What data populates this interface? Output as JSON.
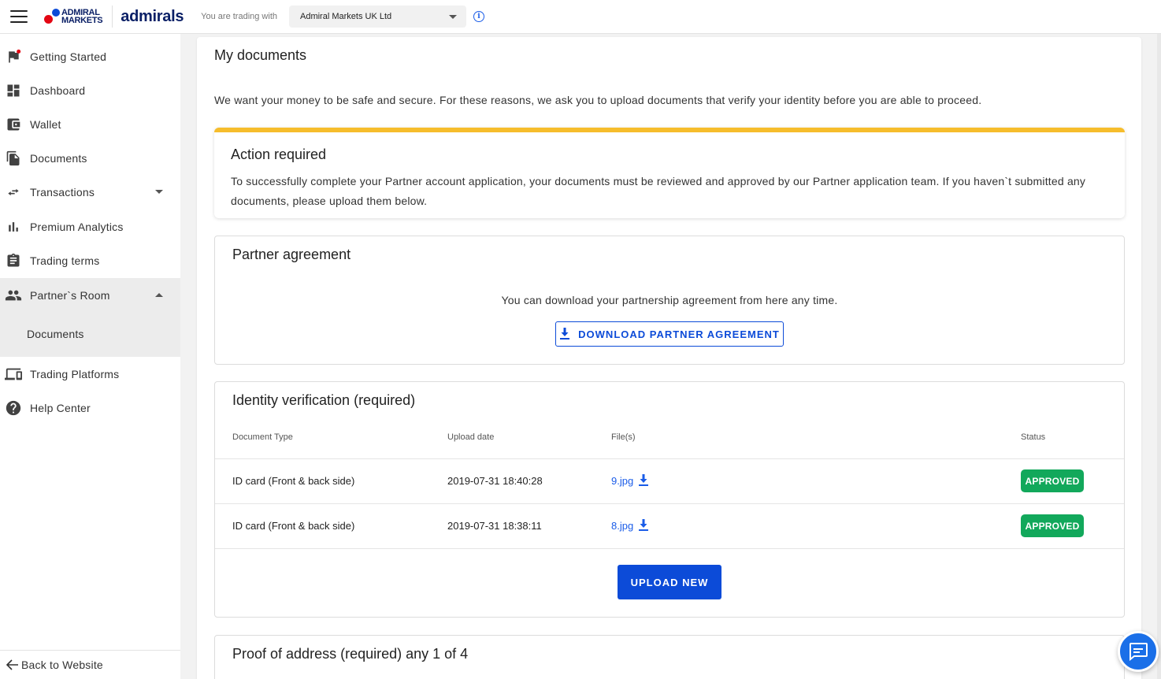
{
  "header": {
    "logo_line1": "ADMIRAL",
    "logo_line2": "MARKETS",
    "brand": "admirals",
    "trading_with_label": "You are trading with",
    "entity": "Admiral Markets UK Ltd",
    "info_glyph": "i"
  },
  "sidebar": {
    "items": [
      {
        "label": "Getting Started",
        "icon": "flag-icon"
      },
      {
        "label": "Dashboard",
        "icon": "dashboard-icon"
      },
      {
        "label": "Wallet",
        "icon": "wallet-icon"
      },
      {
        "label": "Documents",
        "icon": "documents-icon"
      },
      {
        "label": "Transactions",
        "icon": "transactions-icon"
      },
      {
        "label": "Premium Analytics",
        "icon": "bar-chart-icon"
      },
      {
        "label": "Trading terms",
        "icon": "clipboard-icon"
      },
      {
        "label": "Partner`s Room",
        "icon": "people-icon"
      },
      {
        "label": "Trading Platforms",
        "icon": "devices-icon"
      },
      {
        "label": "Help Center",
        "icon": "help-icon"
      }
    ],
    "sub_item": "Documents",
    "back_link": "Back to Website"
  },
  "main": {
    "title": "My documents",
    "intro": "We want your money to be safe and secure. For these reasons, we ask you to upload documents that verify your identity before you are able to proceed.",
    "action": {
      "title": "Action required",
      "text": "To successfully complete your Partner account application, your documents must be reviewed and approved by our Partner application team. If you haven`t submitted any documents, please upload them below."
    },
    "agreement": {
      "title": "Partner agreement",
      "text": "You can download your partnership agreement from here any time.",
      "button": "DOWNLOAD PARTNER AGREEMENT"
    },
    "identity": {
      "title": "Identity verification (required)",
      "columns": [
        "Document Type",
        "Upload date",
        "File(s)",
        "Status"
      ],
      "rows": [
        {
          "type": "ID card (Front & back side)",
          "date": "2019-07-31 18:40:28",
          "file": "9.jpg",
          "status": "APPROVED"
        },
        {
          "type": "ID card (Front & back side)",
          "date": "2019-07-31 18:38:11",
          "file": "8.jpg",
          "status": "APPROVED"
        }
      ],
      "upload_button": "UPLOAD NEW"
    },
    "address": {
      "title": "Proof of address (required) any 1 of 4"
    }
  },
  "colors": {
    "accent": "#0c4bd8",
    "warning": "#f6bd2c",
    "approved": "#12a85b",
    "brand_red": "#e30613"
  }
}
